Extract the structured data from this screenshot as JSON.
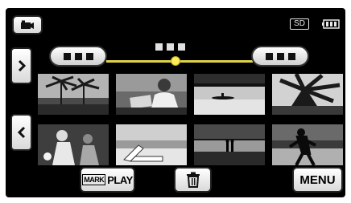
{
  "top_bar": {
    "mode_icon": "video-camera-icon",
    "storage_label": "SD",
    "battery_icon": "battery-icon"
  },
  "navigation": {
    "next_icon": "chevron-right-icon",
    "prev_icon": "chevron-left-icon"
  },
  "timeline": {
    "slider_icon": "date-slider-thumb",
    "track_color": "#e0d34a"
  },
  "thumbnails": [
    {
      "scene": "palm trees against cloudy sky"
    },
    {
      "scene": "person reading a book"
    },
    {
      "scene": "canoe on calm lake"
    },
    {
      "scene": "palm fronds silhouette"
    },
    {
      "scene": "soccer players"
    },
    {
      "scene": "beach chair on shore"
    },
    {
      "scene": "couple at sunset on beach"
    },
    {
      "scene": "person running on beach"
    }
  ],
  "buttons": {
    "mark_label": "MARK",
    "play_label": "PLAY",
    "trash_icon": "trash-icon",
    "menu_label": "MENU"
  }
}
